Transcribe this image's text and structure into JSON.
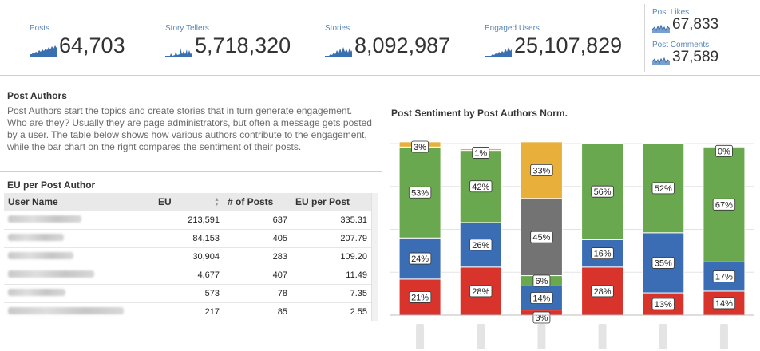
{
  "kpis": [
    {
      "label": "Posts",
      "value": "64,703"
    },
    {
      "label": "Story Tellers",
      "value": "5,718,320"
    },
    {
      "label": "Stories",
      "value": "8,092,987"
    },
    {
      "label": "Engaged Users",
      "value": "25,107,829"
    }
  ],
  "small_kpis": [
    {
      "label": "Post Likes",
      "value": "67,833"
    },
    {
      "label": "Post Comments",
      "value": "37,589"
    }
  ],
  "post_authors": {
    "title": "Post Authors",
    "description": "Post Authors start the topics and create stories that in turn generate engagement. Who are they? Usually they are page administrators, but often a message gets posted by a user. The table below shows how various authors contribute to the engagement, while the bar chart on the right compares the sentiment of their posts."
  },
  "eu_table": {
    "title": "EU per Post Author",
    "headers": [
      "User Name",
      "EU",
      "# of Posts",
      "EU per Post"
    ],
    "rows": [
      {
        "eu": "213,591",
        "posts": "637",
        "eu_per_post": "335.31"
      },
      {
        "eu": "84,153",
        "posts": "405",
        "eu_per_post": "207.79"
      },
      {
        "eu": "30,904",
        "posts": "283",
        "eu_per_post": "109.20"
      },
      {
        "eu": "4,677",
        "posts": "407",
        "eu_per_post": "11.49"
      },
      {
        "eu": "573",
        "posts": "78",
        "eu_per_post": "7.35"
      },
      {
        "eu": "217",
        "posts": "85",
        "eu_per_post": "2.55"
      }
    ]
  },
  "chart_data": {
    "type": "bar",
    "stacked": true,
    "normalized": true,
    "title": "Post Sentiment by Post Authors Norm.",
    "categories": [
      "",
      "",
      "",
      "",
      "",
      ""
    ],
    "ylim": [
      0,
      100
    ],
    "grid": true,
    "legend": "none",
    "series": [
      {
        "color": "#d9342b",
        "values": [
          21,
          28,
          3,
          28,
          13,
          14
        ]
      },
      {
        "color": "#3b6db4",
        "values": [
          24,
          26,
          14,
          16,
          35,
          17
        ]
      },
      {
        "color": "#6aa84f",
        "values": [
          0,
          0,
          6,
          0,
          0,
          0
        ]
      },
      {
        "color": "#737373",
        "values": [
          0,
          0,
          45,
          0,
          0,
          0
        ]
      },
      {
        "color": "#e8b03a",
        "values": [
          0,
          0,
          33,
          0,
          0,
          0
        ]
      },
      {
        "color": "#6aa84f",
        "values": [
          53,
          42,
          0,
          56,
          52,
          67
        ]
      },
      {
        "color": "#e8b03a",
        "values": [
          3,
          1,
          0,
          0,
          0,
          0
        ]
      }
    ],
    "labels": [
      [
        "21%",
        "28%",
        "3%",
        "28%",
        "13%",
        "14%"
      ],
      [
        "24%",
        "26%",
        "14%",
        "16%",
        "35%",
        "17%"
      ],
      [
        "",
        "",
        "6%",
        "",
        "",
        ""
      ],
      [
        "",
        "",
        "45%",
        "",
        "",
        ""
      ],
      [
        "",
        "",
        "33%",
        "",
        "",
        ""
      ],
      [
        "53%",
        "42%",
        "",
        "56%",
        "52%",
        "67%"
      ],
      [
        "3%",
        "1%",
        "",
        "",
        "",
        "0%"
      ]
    ]
  }
}
